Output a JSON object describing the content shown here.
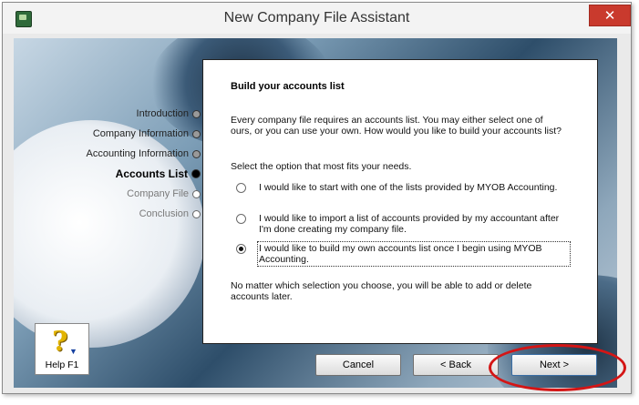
{
  "window": {
    "title": "New Company File Assistant",
    "close_label": "✕"
  },
  "nav": {
    "items": [
      {
        "label": "Introduction",
        "state": "done"
      },
      {
        "label": "Company Information",
        "state": "done"
      },
      {
        "label": "Accounting Information",
        "state": "done"
      },
      {
        "label": "Accounts List",
        "state": "current"
      },
      {
        "label": "Company File",
        "state": "pending"
      },
      {
        "label": "Conclusion",
        "state": "pending"
      }
    ]
  },
  "content": {
    "heading": "Build your accounts list",
    "intro": "Every company file requires an accounts list.  You may either select one of ours, or you can use your own.  How would you like to build your accounts list?",
    "prompt": "Select the option that most fits your needs.",
    "options": [
      {
        "label": "I would like to start with one of the lists provided by MYOB Accounting.",
        "selected": false
      },
      {
        "label": "I would like to import a list of accounts provided by my accountant after I'm done creating my company file.",
        "selected": false
      },
      {
        "label": "I would like to build my own accounts list once I begin using MYOB Accounting.",
        "selected": true
      }
    ],
    "footer": "No matter which selection you choose, you will be able to add or delete accounts later."
  },
  "help": {
    "label": "Help F1"
  },
  "buttons": {
    "cancel": "Cancel",
    "back": "< Back",
    "next": "Next >"
  },
  "colors": {
    "close_button": "#c93a2d",
    "highlight_ring": "#d41515"
  }
}
